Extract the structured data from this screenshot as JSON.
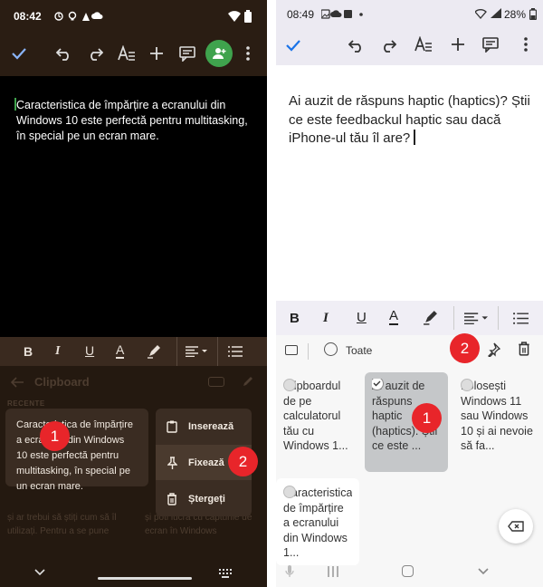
{
  "left": {
    "status": {
      "time": "08:42"
    },
    "document": {
      "text": "Caracteristica de împărțire a ecranului din Windows 10 este perfectă pentru multitasking, în special pe un ecran mare."
    },
    "clipboard": {
      "title": "Clipboard",
      "section": "RECENTE",
      "item_text": "Caracteristica de împărțire a ecranului din Windows 10 este perfectă pentru multitasking, în special pe un ecran mare.",
      "bg_text_1": "și ar trebui să știți cum să îl utilizați. Pentru a se pune",
      "bg_text_2": "și poti lucra cu capturile de ecran în Windows"
    },
    "context_menu": {
      "insert_label": "Inserează",
      "pin_label": "Fixează",
      "delete_label": "Ștergeți"
    },
    "badges": {
      "one": "1",
      "two": "2"
    }
  },
  "right": {
    "status": {
      "time": "08:49",
      "battery": "28%"
    },
    "document": {
      "text": "Ai auzit de răspuns haptic (haptics)? Știi ce este feedbackul haptic sau dacă iPhone-ul tău îl are?"
    },
    "clipboard": {
      "filter_label": "Toate",
      "items": [
        "Clipboardul de pe calculatorul tău cu Windows 1...",
        "Ai auzit de răspuns haptic (haptics). Știi ce este ...",
        "Folosești Windows 11 sau Windows 10 și ai nevoie să fa...",
        "Caracteristica de împărțire a ecranului din Windows 1..."
      ]
    },
    "badges": {
      "one": "1",
      "two": "2"
    }
  },
  "colors": {
    "accent_green": "#3fa34d",
    "badge_red": "#e8252a",
    "selected_card": "#c5c7c9"
  }
}
